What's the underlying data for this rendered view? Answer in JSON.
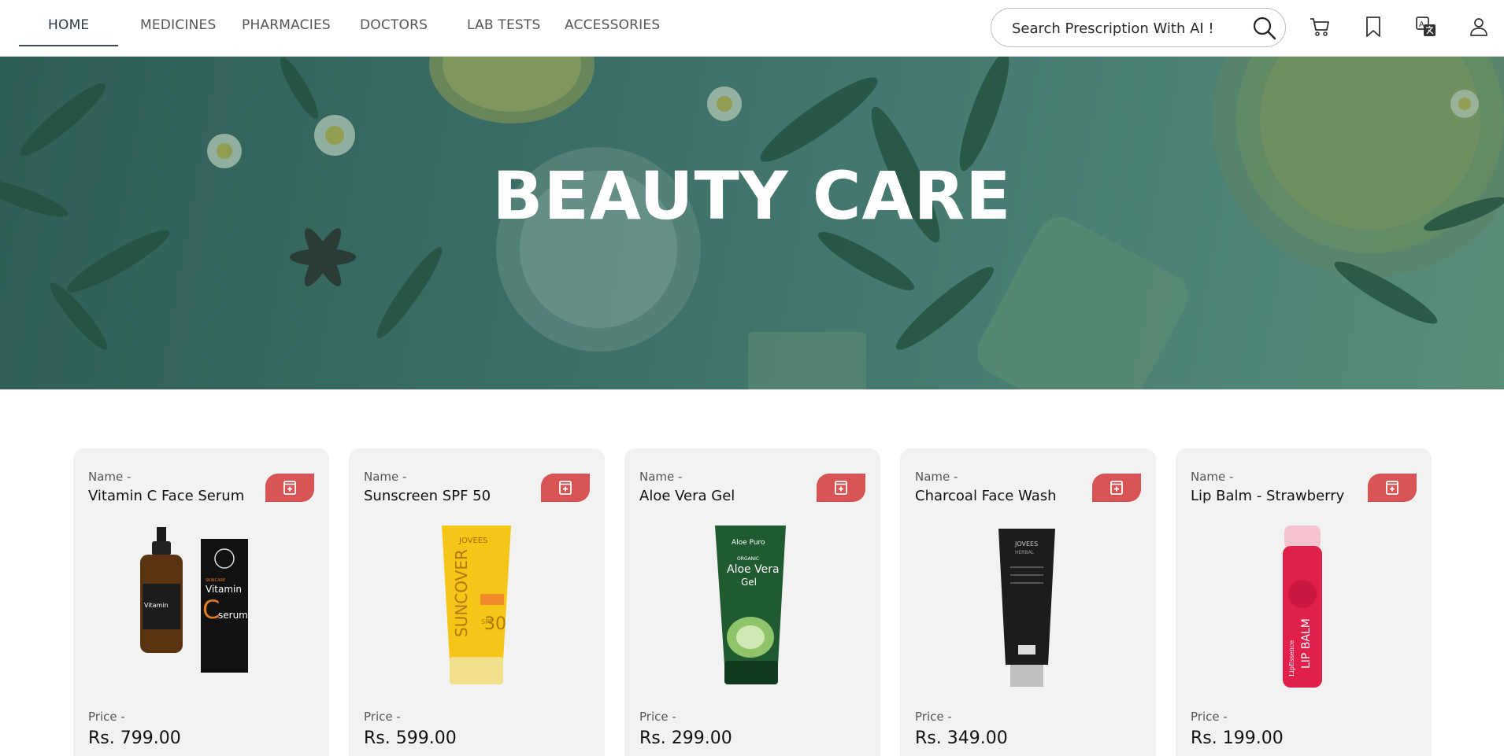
{
  "nav": {
    "items": [
      {
        "label": "HOME",
        "active": true
      },
      {
        "label": "MEDICINES"
      },
      {
        "label": "PHARMACIES"
      },
      {
        "label": "DOCTORS"
      },
      {
        "label": "LAB TESTS"
      },
      {
        "label": "ACCESSORIES"
      }
    ],
    "search": {
      "placeholder": "Search Prescription With AI !",
      "icon": "search-icon"
    },
    "icons": [
      "cart-icon",
      "bookmark-icon",
      "translate-icon",
      "user-icon"
    ]
  },
  "hero": {
    "title": "BEAUTY CARE"
  },
  "products": [
    {
      "name_label": "Name -",
      "name": "Vitamin C Face Serum",
      "price_label": "Price -",
      "price": "Rs. 799.00",
      "image_text": [
        "Vitamin",
        "C",
        "serum",
        "SKINCARE"
      ]
    },
    {
      "name_label": "Name -",
      "name": "Sunscreen SPF 50",
      "price_label": "Price -",
      "price": "Rs. 599.00",
      "image_text": [
        "JOVEES",
        "SUNCOVER",
        "SPF",
        "30"
      ]
    },
    {
      "name_label": "Name -",
      "name": "Aloe Vera Gel",
      "price_label": "Price -",
      "price": "Rs. 299.00",
      "image_text": [
        "Aloe Puro",
        "ORGANIC",
        "Aloe Vera",
        "Gel"
      ]
    },
    {
      "name_label": "Name -",
      "name": "Charcoal Face Wash",
      "price_label": "Price -",
      "price": "Rs. 349.00",
      "image_text": [
        "JOVEES",
        "HERBAL"
      ]
    },
    {
      "name_label": "Name -",
      "name": "Lip Balm - Strawberry",
      "price_label": "Price -",
      "price": "Rs. 199.00",
      "image_text": [
        "LIP BALM",
        "LipEssence"
      ]
    }
  ],
  "colors": {
    "accent": "#d85353",
    "card_bg": "#f2f2f2",
    "hero": "#3f6e66"
  }
}
